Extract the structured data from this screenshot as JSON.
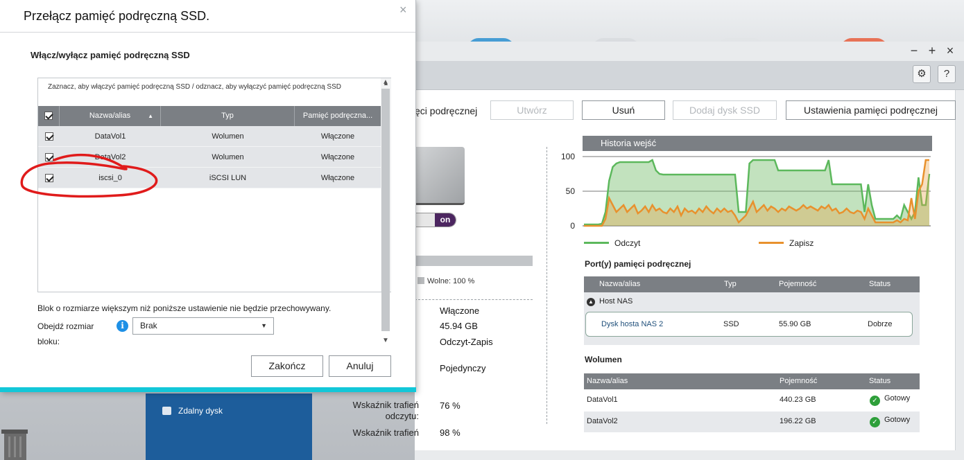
{
  "dialog": {
    "title": "Przełącz pamięć podręczną SSD.",
    "subtitle": "Włącz/wyłącz pamięć podręczną SSD",
    "description": "Zaznacz, aby włączyć pamięć podręczną SSD / odznacz, aby wyłączyć pamięć podręczną SSD",
    "columns": [
      "Nazwa/alias",
      "Typ",
      "Pamięć podręczna..."
    ],
    "rows": [
      {
        "name": "DataVol1",
        "type": "Wolumen",
        "cache": "Włączone"
      },
      {
        "name": "DataVol2",
        "type": "Wolumen",
        "cache": "Włączone"
      },
      {
        "name": "iscsi_0",
        "type": "iSCSI LUN",
        "cache": "Włączone"
      }
    ],
    "block_note": "Blok o rozmiarze większym niż poniższe ustawienie nie będzie przechowywany.",
    "bypass_label": "Obejdź rozmiar bloku:",
    "bypass_value": "Brak",
    "finish_label": "Zakończ",
    "cancel_label": "Anuluj",
    "accent_color": "#12c7d8"
  },
  "app": {
    "cache_title": "ęci podręcznej",
    "buttons": {
      "create": "Utwórz",
      "remove": "Usuń",
      "add_ssd": "Dodaj dysk SSD",
      "settings": "Ustawienia pamięci podręcznej"
    },
    "toggle_label": "on",
    "free_label": "Wolne: 100 %",
    "info": {
      "status_value": "Włączone",
      "capacity_value": "45.94 GB",
      "mode_value": "Odczyt-Zapis",
      "raid_value": "Pojedynczy",
      "read_hit_key": "Wskaźnik trafień odczytu:",
      "read_hit_value": "76 %",
      "hit_key": "Wskaźnik trafień",
      "hit_value": "98 %"
    },
    "ports_title": "Port(y) pamięci podręcznej",
    "ports_columns": [
      "Nazwa/alias",
      "Typ",
      "Pojemność",
      "Status"
    ],
    "host_label": "Host NAS",
    "host_disk": {
      "name": "Dysk hosta NAS 2",
      "type": "SSD",
      "capacity": "55.90 GB",
      "status": "Dobrze"
    },
    "volumes_title": "Wolumen",
    "volumes_columns": [
      "Nazwa/alias",
      "Pojemność",
      "Status"
    ],
    "volumes": [
      {
        "name": "DataVol1",
        "capacity": "440.23 GB",
        "status": "Gotowy"
      },
      {
        "name": "DataVol2",
        "capacity": "196.22 GB",
        "status": "Gotowy"
      }
    ],
    "sidebar_item": "Zdalny dysk"
  },
  "chart_data": {
    "type": "area",
    "title": "Historia wejść",
    "ylim": [
      0,
      100
    ],
    "yticks": [
      "100",
      "50",
      "0"
    ],
    "series": [
      {
        "name": "Odczyt",
        "color": "#5cb85c",
        "values": [
          2,
          2,
          2,
          2,
          2,
          3,
          20,
          65,
          85,
          90,
          92,
          92,
          92,
          92,
          92,
          92,
          92,
          92,
          92,
          95,
          80,
          75,
          74,
          74,
          74,
          74,
          74,
          74,
          74,
          74,
          74,
          74,
          74,
          74,
          74,
          74,
          74,
          74,
          74,
          74,
          74,
          74,
          74,
          20,
          20,
          20,
          90,
          95,
          95,
          95,
          95,
          95,
          95,
          95,
          80,
          80,
          80,
          80,
          80,
          80,
          80,
          80,
          80,
          80,
          80,
          80,
          80,
          80,
          95,
          60,
          60,
          60,
          60,
          60,
          60,
          60,
          60,
          60,
          20,
          60,
          30,
          10,
          10,
          10,
          10,
          10,
          10,
          15,
          10,
          30,
          20,
          10,
          20,
          70,
          30,
          30,
          75
        ]
      },
      {
        "name": "Zapisz",
        "color": "#e8912d",
        "values": [
          0,
          0,
          0,
          0,
          0,
          0,
          10,
          40,
          30,
          20,
          25,
          30,
          20,
          25,
          30,
          18,
          22,
          28,
          20,
          30,
          22,
          25,
          20,
          18,
          25,
          20,
          28,
          15,
          25,
          20,
          22,
          18,
          25,
          20,
          28,
          22,
          18,
          25,
          20,
          25,
          20,
          22,
          15,
          5,
          10,
          15,
          25,
          35,
          20,
          25,
          30,
          22,
          28,
          25,
          20,
          25,
          22,
          28,
          25,
          22,
          25,
          30,
          25,
          28,
          25,
          22,
          28,
          25,
          30,
          22,
          25,
          18,
          20,
          25,
          20,
          18,
          22,
          20,
          10,
          25,
          15,
          5,
          5,
          5,
          5,
          5,
          5,
          8,
          5,
          10,
          8,
          40,
          10,
          50,
          60,
          95,
          95
        ]
      }
    ]
  }
}
